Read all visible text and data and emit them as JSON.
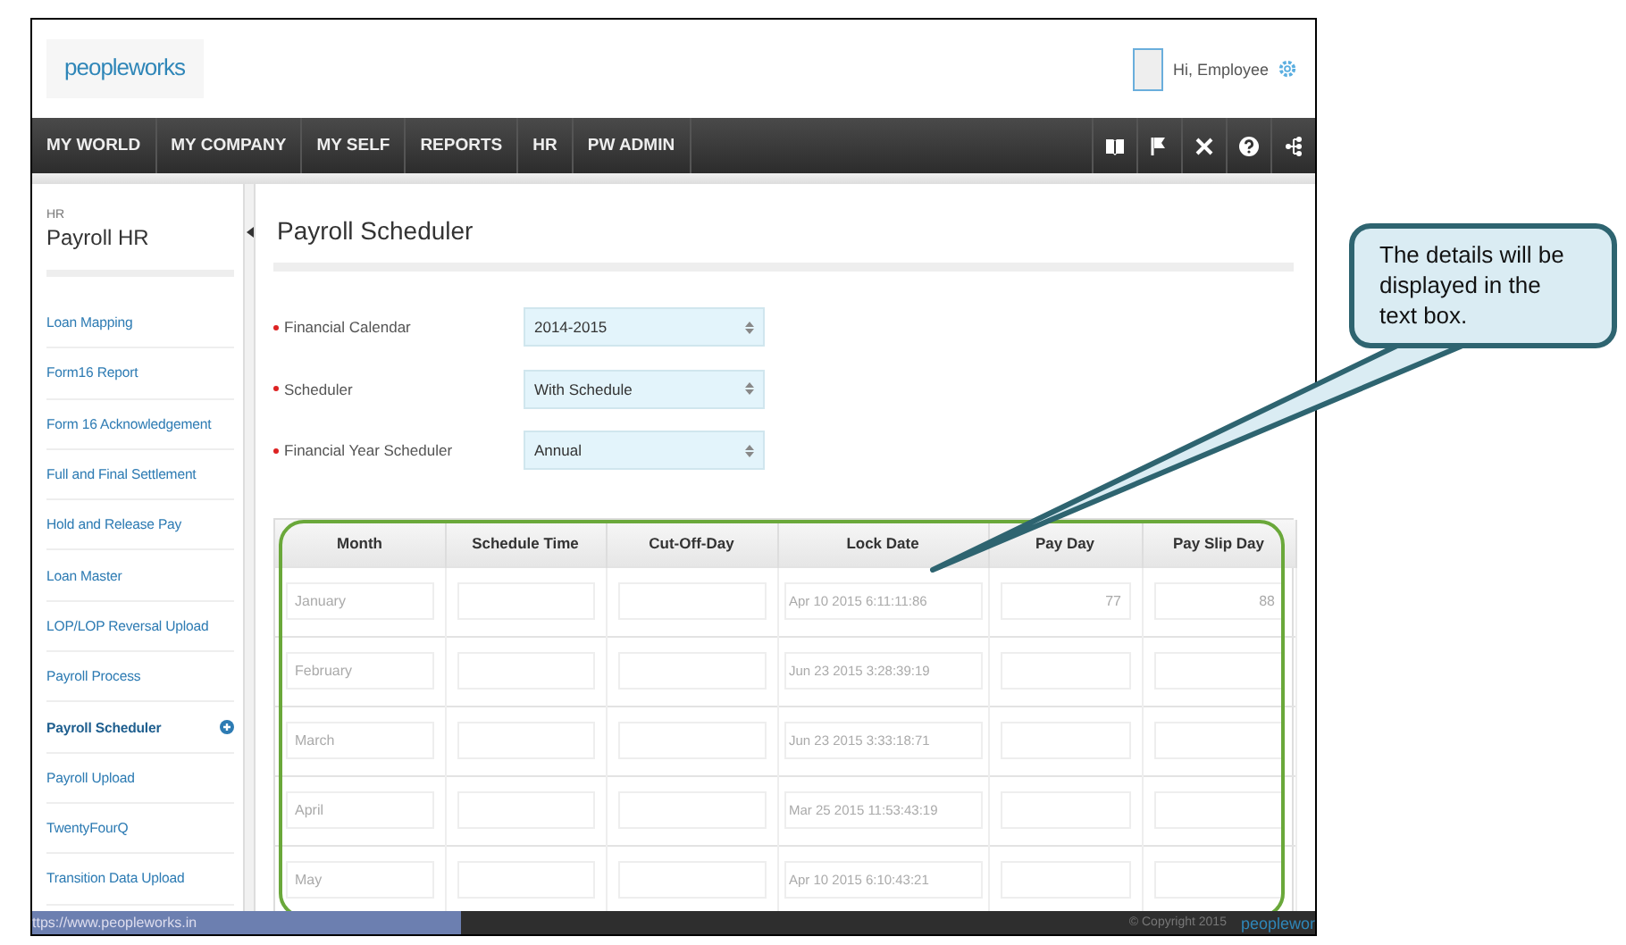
{
  "header": {
    "logo": "peopleworks",
    "greeting": "Hi, Employee"
  },
  "nav": {
    "items": [
      {
        "label": "MY WORLD"
      },
      {
        "label": "MY COMPANY"
      },
      {
        "label": "MY SELF"
      },
      {
        "label": "REPORTS"
      },
      {
        "label": "HR"
      },
      {
        "label": "PW ADMIN"
      }
    ]
  },
  "sidebar": {
    "section": "HR",
    "title": "Payroll HR",
    "items": [
      {
        "label": "Loan Mapping",
        "selected": false
      },
      {
        "label": "Form16 Report",
        "selected": false
      },
      {
        "label": "Form 16 Acknowledgement",
        "selected": false
      },
      {
        "label": "Full and Final Settlement",
        "selected": false
      },
      {
        "label": "Hold and Release Pay",
        "selected": false
      },
      {
        "label": "Loan Master",
        "selected": false
      },
      {
        "label": "LOP/LOP Reversal Upload",
        "selected": false
      },
      {
        "label": "Payroll Process",
        "selected": false
      },
      {
        "label": "Payroll Scheduler",
        "selected": true
      },
      {
        "label": "Payroll Upload",
        "selected": false
      },
      {
        "label": "TwentyFourQ",
        "selected": false
      },
      {
        "label": "Transition Data Upload",
        "selected": false
      }
    ]
  },
  "main": {
    "title": "Payroll Scheduler",
    "fields": [
      {
        "label": "Financial Calendar",
        "value": "2014-2015",
        "required": true
      },
      {
        "label": "Scheduler",
        "value": "With Schedule",
        "required": true
      },
      {
        "label": "Financial Year Scheduler",
        "value": "Annual",
        "required": true
      }
    ],
    "table": {
      "columns": [
        "Month",
        "Schedule Time",
        "Cut-Off-Day",
        "Lock Date",
        "Pay Day",
        "Pay Slip Day"
      ],
      "rows": [
        {
          "month": "January",
          "lock_date": "Apr 10 2015 6:11:11:86",
          "pay_day": "77",
          "pay_slip_day": "88"
        },
        {
          "month": "February",
          "lock_date": "Jun 23 2015 3:28:39:19"
        },
        {
          "month": "March",
          "lock_date": "Jun 23 2015 3:33:18:71"
        },
        {
          "month": "April",
          "lock_date": "Mar 25 2015 11:53:43:19"
        },
        {
          "month": "May",
          "lock_date": "Apr 10 2015 6:10:43:21"
        }
      ]
    }
  },
  "footer": {
    "url": "ttps://www.peopleworks.in",
    "copyright": "© Copyright 2015",
    "logo": "peoplewor"
  },
  "callout": {
    "text": "The details will be displayed in the text box."
  }
}
